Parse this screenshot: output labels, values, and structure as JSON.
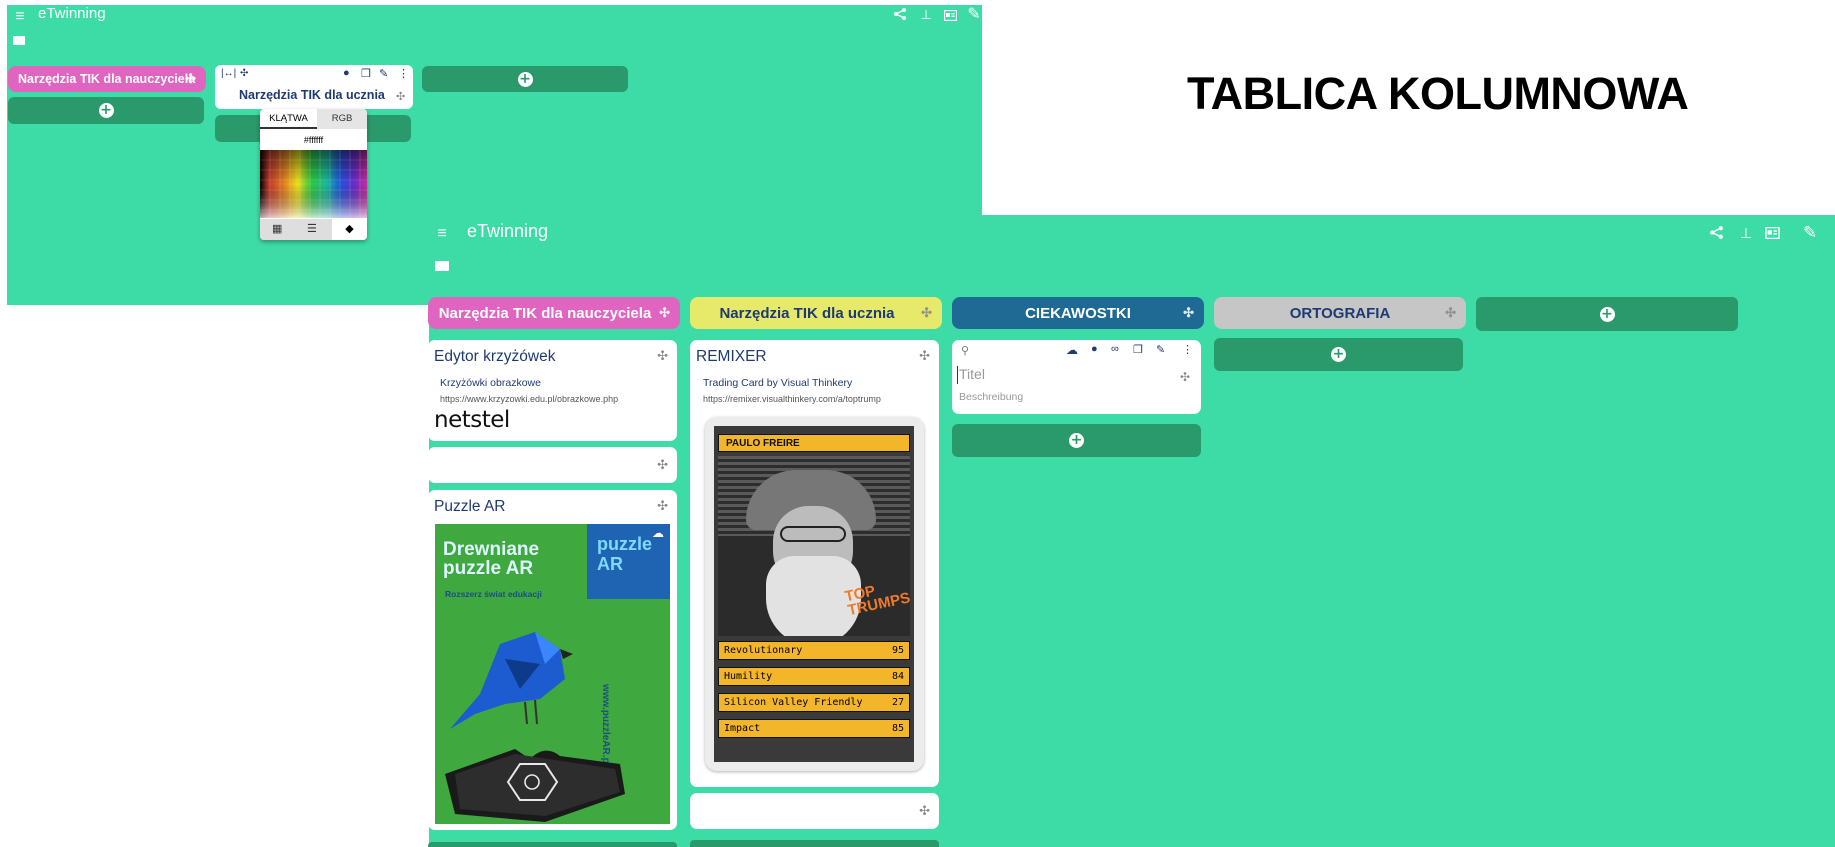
{
  "slide_title": "TABLICA KOLUMNOWA",
  "top_screenshot": {
    "app_title": "eTwinning",
    "columns": [
      {
        "title": "Narzędzia TIK dla nauczyciela"
      },
      {
        "title": "Narzędzia TIK dla ucznia"
      }
    ],
    "color_picker": {
      "tabs": [
        "KLĄTWA",
        "RGB"
      ],
      "hex_value": "#ffffff"
    }
  },
  "bottom_screenshot": {
    "app_title": "eTwinning",
    "columns": [
      {
        "title": "Narzędzia TIK dla nauczyciela",
        "color": "#e065c0",
        "cards": [
          {
            "title": "Edytor krzyżówek",
            "link_label": "Krzyżówki obrazkowe",
            "link_url": "https://www.krzyzowki.edu.pl/obrazkowe.php",
            "logo_text": "netstel"
          },
          {
            "title": ""
          },
          {
            "title": "Puzzle AR",
            "image": {
              "headline": "Drewniane puzzle AR",
              "subline": "Rozszerz świat edukacji",
              "brand": "puzzle AR",
              "side_url": "www.puzzleAR.pl"
            }
          }
        ]
      },
      {
        "title": "Narzędzia TIK dla ucznia",
        "color": "#e6e96a",
        "cards": [
          {
            "title": "REMIXER",
            "link_label": "Trading Card by Visual Thinkery",
            "link_url": "https://remixer.visualthinkery.com/a/toptrump",
            "trading_card": {
              "name": "PAULO FREIRE",
              "badge": "TOP TRUMPS",
              "stats": [
                {
                  "label": "Revolutionary",
                  "value": "95"
                },
                {
                  "label": "Humility",
                  "value": "84"
                },
                {
                  "label": "Silicon Valley Friendly",
                  "value": "27"
                },
                {
                  "label": "Impact",
                  "value": "85"
                }
              ]
            }
          },
          {
            "title": ""
          }
        ]
      },
      {
        "title": "CIEKAWOSTKI",
        "color": "#1e6a94",
        "editor": {
          "title_placeholder": "Titel",
          "description_placeholder": "Beschreibung"
        }
      },
      {
        "title": "ORTOGRAFIA",
        "color": "#c6c6c6"
      }
    ]
  },
  "colors": {
    "board_background": "#3ddca6",
    "add_button": "#2a9a6c",
    "card_title": "#1e3a72",
    "trading_card_yellow": "#f3b52a"
  }
}
